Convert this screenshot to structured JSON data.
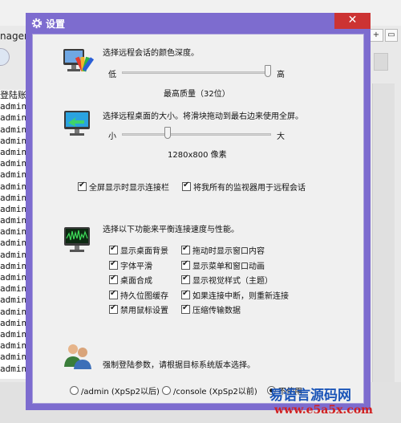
{
  "background": {
    "title_fragment": "nager",
    "btn_a": "+",
    "btn_b": "▭",
    "list_rows": [
      "登陆账",
      "admin",
      "admin",
      "admin",
      "admin",
      "admin",
      "admin",
      "admin",
      "admin",
      "admin",
      "admin",
      "admin",
      "admin",
      "admin",
      "admin",
      "admin",
      "admin",
      "admin",
      "admin",
      "admin",
      "admin",
      "admin",
      "admin",
      "admin",
      "admin"
    ]
  },
  "dialog": {
    "title": "设置",
    "close_glyph": "✕",
    "color_depth": {
      "description": "选择远程会话的颜色深度。",
      "low": "低",
      "high": "高",
      "value_label": "最高质量（32位）",
      "level": 1.0
    },
    "screen_size": {
      "description": "选择远程桌面的大小。将滑块拖动到最右边来使用全屏。",
      "small": "小",
      "large": "大",
      "value_label": "1280x800 像素",
      "level": 0.3
    },
    "fullscreen_bar": "全屏显示时显示连接栏",
    "all_monitors": "将我所有的监视器用于远程会话",
    "performance": {
      "description": "选择以下功能来平衡连接速度与性能。",
      "options": [
        "显示桌面背景",
        "拖动时显示窗口内容",
        "字体平滑",
        "显示菜单和窗口动画",
        "桌面合成",
        "显示视觉样式（主题）",
        "持久位图缓存",
        "如果连接中断，则重新连接",
        "禁用鼠标设置",
        "压缩传输数据"
      ]
    },
    "admin_mode": {
      "description": "强制登陆参数，请根据目标系统版本选择。",
      "options": [
        "/admin (XpSp2以后)",
        "/console (XpSp2以前)",
        "不使用"
      ],
      "selected": 2
    }
  },
  "watermark": {
    "name": "易语言源码网",
    "url": "www.e5a5x.com"
  },
  "colors": {
    "dialog_frame": "#7d6ccf",
    "client_bg": "#f0f0f0",
    "watermark_blue": "#1b55b8",
    "watermark_red": "#d12020"
  }
}
